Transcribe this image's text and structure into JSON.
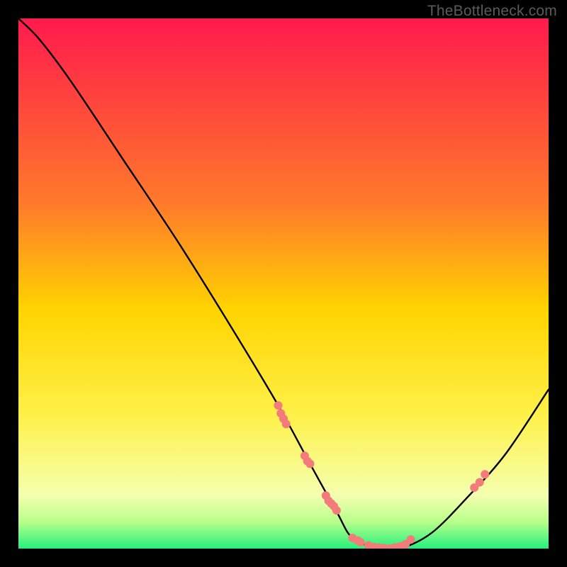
{
  "watermark": "TheBottleneck.com",
  "chart_data": {
    "type": "line",
    "title": "",
    "xlabel": "",
    "ylabel": "",
    "xlim": [
      0,
      100
    ],
    "ylim": [
      0,
      100
    ],
    "gradient_stops": [
      {
        "offset": 0,
        "color": "#ff1a4d"
      },
      {
        "offset": 35,
        "color": "#ff7a2a"
      },
      {
        "offset": 55,
        "color": "#ffd400"
      },
      {
        "offset": 75,
        "color": "#fff14a"
      },
      {
        "offset": 90,
        "color": "#f5ffb0"
      },
      {
        "offset": 95,
        "color": "#b7ff8a"
      },
      {
        "offset": 100,
        "color": "#26ef7e"
      }
    ],
    "series": [
      {
        "name": "bottleneck-curve",
        "x": [
          0,
          4,
          10,
          20,
          30,
          40,
          49,
          55,
          60,
          63,
          68,
          72,
          78,
          85,
          92,
          100
        ],
        "y": [
          100,
          96,
          88,
          73,
          58,
          42,
          27,
          16,
          7,
          2,
          0,
          0,
          3,
          10,
          18,
          30
        ]
      }
    ],
    "markers": [
      {
        "x": 49.0,
        "y": 27.0
      },
      {
        "x": 49.5,
        "y": 25.5
      },
      {
        "x": 50.0,
        "y": 24.5
      },
      {
        "x": 50.5,
        "y": 23.5
      },
      {
        "x": 54.0,
        "y": 17.5
      },
      {
        "x": 54.5,
        "y": 16.5
      },
      {
        "x": 55.0,
        "y": 16.0
      },
      {
        "x": 58.0,
        "y": 10.0
      },
      {
        "x": 58.5,
        "y": 9.0
      },
      {
        "x": 59.0,
        "y": 8.5
      },
      {
        "x": 59.5,
        "y": 8.0
      },
      {
        "x": 60.0,
        "y": 7.2
      },
      {
        "x": 63.0,
        "y": 2.0
      },
      {
        "x": 64.0,
        "y": 1.5
      },
      {
        "x": 64.5,
        "y": 1.2
      },
      {
        "x": 66.0,
        "y": 0.6
      },
      {
        "x": 67.0,
        "y": 0.3
      },
      {
        "x": 68.0,
        "y": 0.2
      },
      {
        "x": 69.0,
        "y": 0.1
      },
      {
        "x": 70.0,
        "y": 0.0
      },
      {
        "x": 71.0,
        "y": 0.2
      },
      {
        "x": 72.0,
        "y": 0.4
      },
      {
        "x": 73.0,
        "y": 0.8
      },
      {
        "x": 74.0,
        "y": 1.7
      },
      {
        "x": 86.0,
        "y": 11.5
      },
      {
        "x": 87.0,
        "y": 12.5
      },
      {
        "x": 88.0,
        "y": 14.0
      }
    ],
    "marker_style": {
      "fill": "#f47b7b",
      "r": 6
    }
  }
}
